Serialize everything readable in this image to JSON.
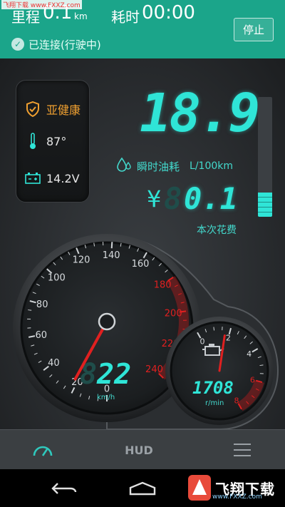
{
  "watermark_top": "飞翔下载 www.FXXZ.com",
  "header": {
    "trip_label": "里程",
    "trip_value": "0.1",
    "trip_unit": "km",
    "time_label": "耗时",
    "time_value": "00:00",
    "stop_label": "停止",
    "connection_status": "已连接(行驶中)"
  },
  "status_panel": {
    "health": "亚健康",
    "coolant_temp": "87°",
    "battery_voltage": "14.2V"
  },
  "fuel": {
    "instant_value": "18.9",
    "instant_label": "瞬时油耗",
    "unit": "L/100km",
    "cost_symbol": "¥",
    "cost_ghost_digit": "8",
    "cost_value": "0.1",
    "cost_label": "本次花费",
    "level_fraction": 0.2
  },
  "speedometer": {
    "ticks": [
      "0",
      "20",
      "40",
      "60",
      "80",
      "100",
      "120",
      "140",
      "160",
      "180",
      "200",
      "220",
      "240"
    ],
    "red_from": 180,
    "speed": 22,
    "ghost_digit": "8",
    "readout": "22",
    "unit": "km/h"
  },
  "tachometer": {
    "ticks": [
      "0",
      "2",
      "4",
      "6",
      "8"
    ],
    "red_from": 6,
    "rpm_thousands": 1.708,
    "readout": "1708",
    "unit": "r/min"
  },
  "bottom_nav": {
    "hud_label": "HUD"
  },
  "colors": {
    "header_bg": "#1ba58a",
    "digit": "#2fe5d7",
    "warning": "#f0a030",
    "redline": "#e02020"
  },
  "icons": {
    "health": "shield-check-icon",
    "temperature": "thermometer-icon",
    "battery": "battery-icon",
    "fuel_drop": "water-drops-icon",
    "engine": "engine-icon",
    "dashboard": "gauge-icon",
    "menu": "menu-icon",
    "back": "back-icon",
    "home": "home-icon"
  },
  "logo": {
    "text": "飞翔下载",
    "url": "www.FXXZ.com"
  }
}
